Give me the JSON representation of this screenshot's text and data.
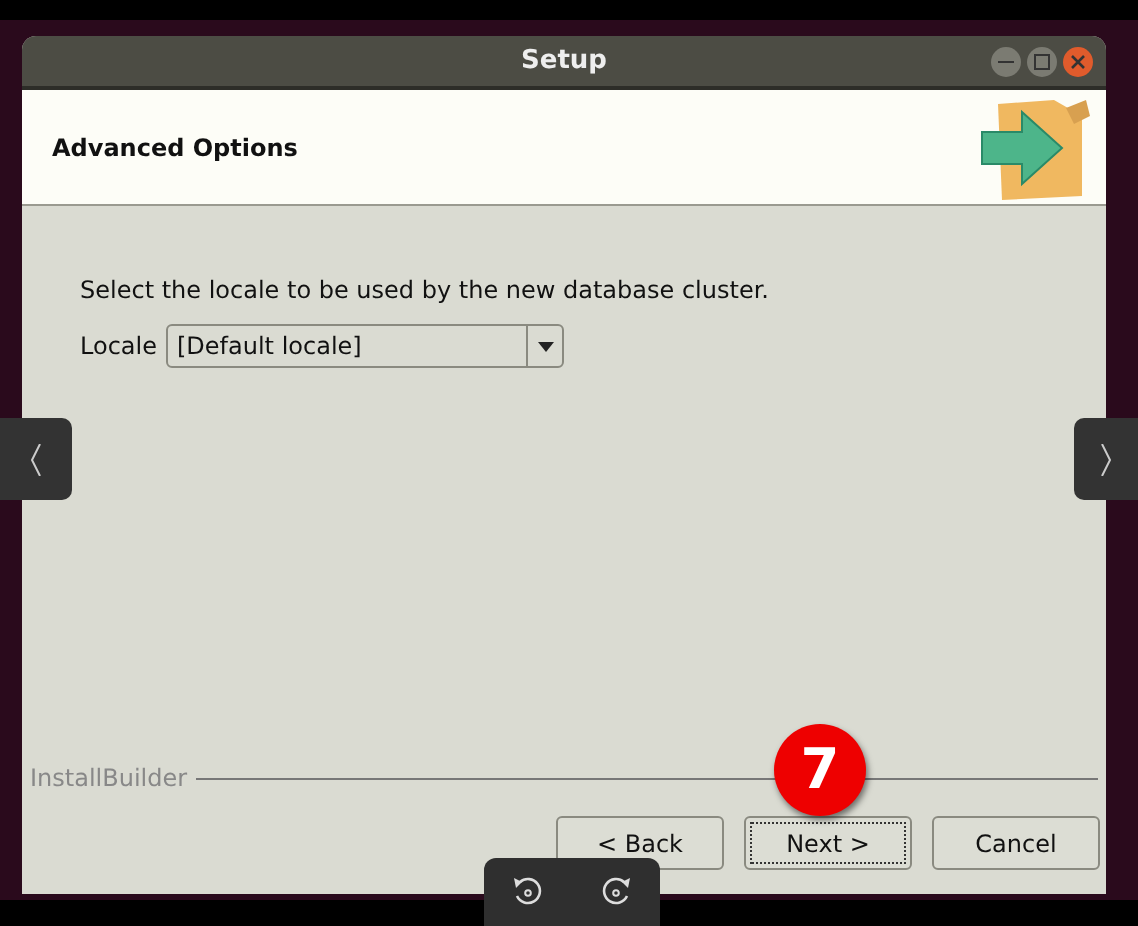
{
  "window": {
    "title": "Setup"
  },
  "header": {
    "title": "Advanced Options"
  },
  "content": {
    "instruction": "Select the locale to be used by the new database cluster.",
    "locale_label": "Locale",
    "locale_value": "[Default locale]"
  },
  "footer": {
    "brand": "InstallBuilder",
    "buttons": [
      {
        "label": "< Back",
        "focused": false
      },
      {
        "label": "Next >",
        "focused": true
      },
      {
        "label": "Cancel",
        "focused": false
      }
    ]
  },
  "step_badge": "7"
}
